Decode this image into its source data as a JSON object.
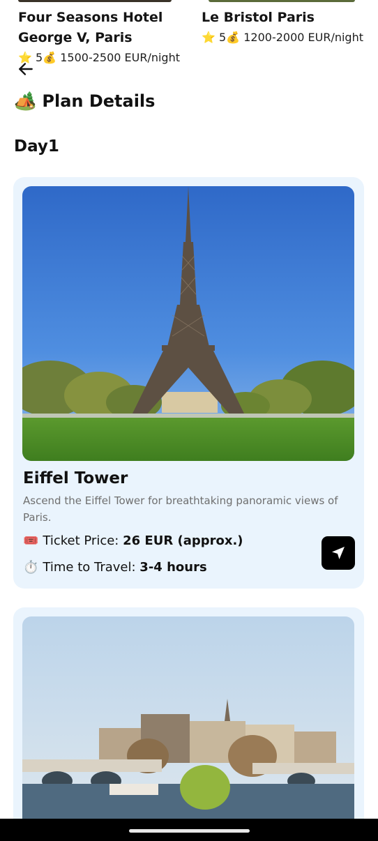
{
  "hotels": [
    {
      "name": "Four Seasons Hotel George V, Paris",
      "rating_icon": "⭐",
      "rating": "5",
      "price_icon": "💰",
      "price": "1500-2500 EUR/night"
    },
    {
      "name": "Le Bristol Paris",
      "rating_icon": "⭐",
      "rating": "5",
      "price_icon": "💰",
      "price": "1200-2000 EUR/night"
    }
  ],
  "header": {
    "back_icon": "arrow-left-icon"
  },
  "plan": {
    "title_icon": "🏕️",
    "title": "Plan Details",
    "day_label": "Day1"
  },
  "places": [
    {
      "name": "Eiffel Tower",
      "description": "Ascend the Eiffel Tower for breathtaking panoramic views of Paris.",
      "ticket_icon": "🎟️",
      "ticket_label": "Ticket Price:",
      "ticket_value": "26 EUR (approx.)",
      "time_icon": "⏱️",
      "time_label": "Time to Travel:",
      "time_value": "3-4 hours",
      "nav_icon": "navigation-arrow-icon"
    }
  ],
  "colors": {
    "card_background": "#eaf4fd",
    "nav_button": "#000000",
    "description_text": "#6f6f6f"
  }
}
